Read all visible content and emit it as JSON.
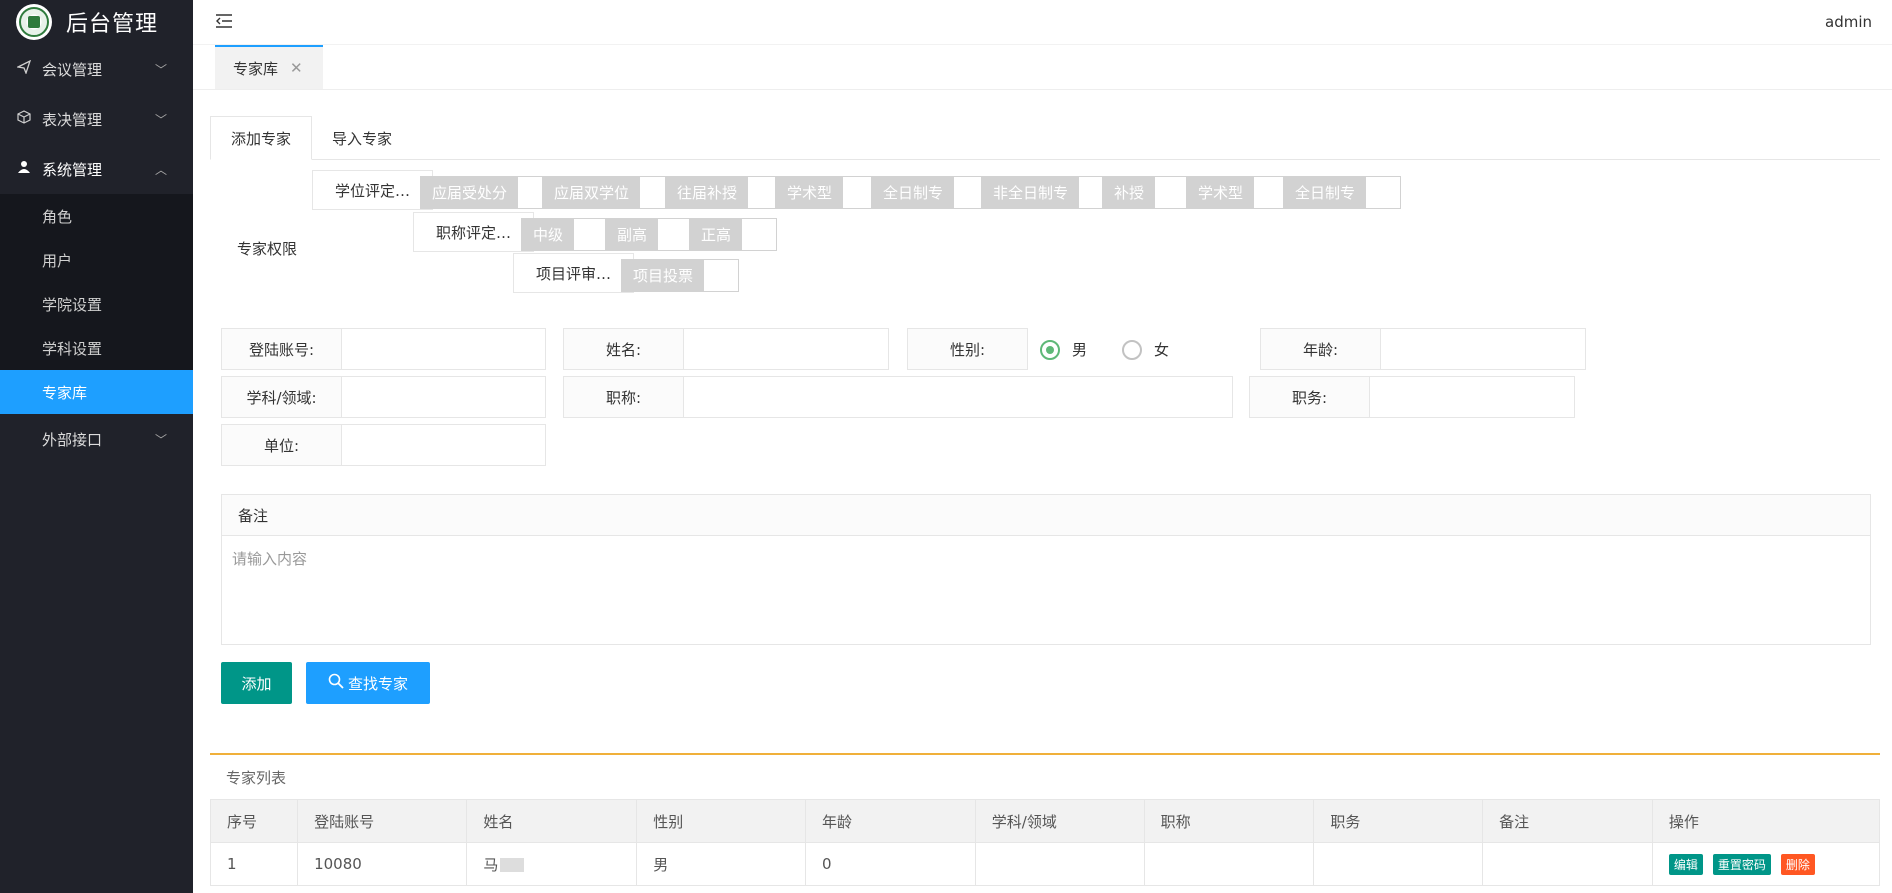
{
  "sidebar": {
    "title": "后台管理",
    "menu": [
      {
        "label": "会议管理",
        "icon": "send-icon"
      },
      {
        "label": "表决管理",
        "icon": "cube-icon"
      },
      {
        "label": "系统管理",
        "icon": "user-icon"
      },
      {
        "label": "外部接口",
        "icon": ""
      }
    ],
    "submenu": [
      "角色",
      "用户",
      "学院设置",
      "学科设置",
      "专家库"
    ]
  },
  "header": {
    "user": "admin"
  },
  "open_tab": {
    "label": "专家库"
  },
  "subtabs": [
    "添加专家",
    "导入专家"
  ],
  "permissions": {
    "label": "专家权限",
    "groups": [
      "学位评定…",
      "职称评定…",
      "项目评审…"
    ],
    "row1_switches": [
      "应届受处分",
      "应届双学位",
      "往届补授",
      "学术型",
      "全日制专",
      "非全日制专",
      "补授",
      "学术型",
      "全日制专"
    ],
    "row2_switches": [
      "中级",
      "副高",
      "正高"
    ],
    "row3_switches": [
      "项目投票"
    ]
  },
  "form": {
    "login_label": "登陆账号:",
    "name_label": "姓名:",
    "gender_label": "性别:",
    "gender_male": "男",
    "gender_female": "女",
    "age_label": "年龄:",
    "subject_label": "学科/领域:",
    "title_label": "职称:",
    "duty_label": "职务:",
    "unit_label": "单位:",
    "remark_label": "备注",
    "remark_placeholder": "请输入内容"
  },
  "actions": {
    "add": "添加",
    "search": "查找专家"
  },
  "list": {
    "title": "专家列表",
    "columns": [
      "序号",
      "登陆账号",
      "姓名",
      "性别",
      "年龄",
      "学科/领域",
      "职称",
      "职务",
      "备注",
      "操作"
    ],
    "rows": [
      {
        "no": "1",
        "account": "10080",
        "name": "马",
        "gender": "男",
        "age": "0",
        "subject": "",
        "title": "",
        "duty": "",
        "remark": ""
      }
    ],
    "ops": {
      "edit": "编辑",
      "reset": "重置密码",
      "delete": "删除"
    }
  },
  "colors": {
    "sidebar_bg": "#20222a",
    "active": "#1e9fff",
    "add_btn": "#009688",
    "delete": "#ff5722",
    "accent_line": "#f0b03a"
  }
}
